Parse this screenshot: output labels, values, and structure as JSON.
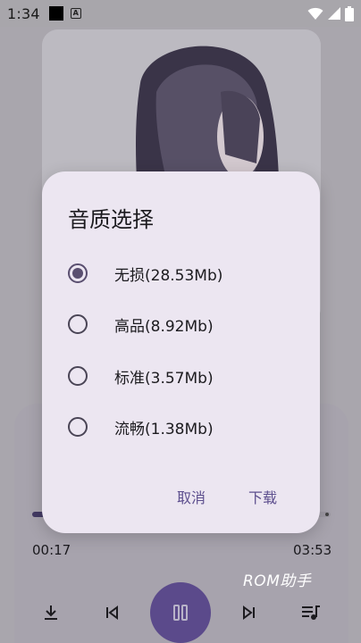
{
  "status_bar": {
    "time": "1:34",
    "notification_icon": "a-icon"
  },
  "player": {
    "elapsed": "00:17",
    "duration": "03:53",
    "progress_fraction": 0.073,
    "watermark": "ROM助手",
    "accent_color": "#5b4a8b"
  },
  "dialog": {
    "title": "音质选择",
    "options": [
      {
        "label": "无损(28.53Mb)",
        "selected": true
      },
      {
        "label": "高品(8.92Mb)",
        "selected": false
      },
      {
        "label": "标准(3.57Mb)",
        "selected": false
      },
      {
        "label": "流畅(1.38Mb)",
        "selected": false
      }
    ],
    "cancel_label": "取消",
    "download_label": "下载"
  }
}
